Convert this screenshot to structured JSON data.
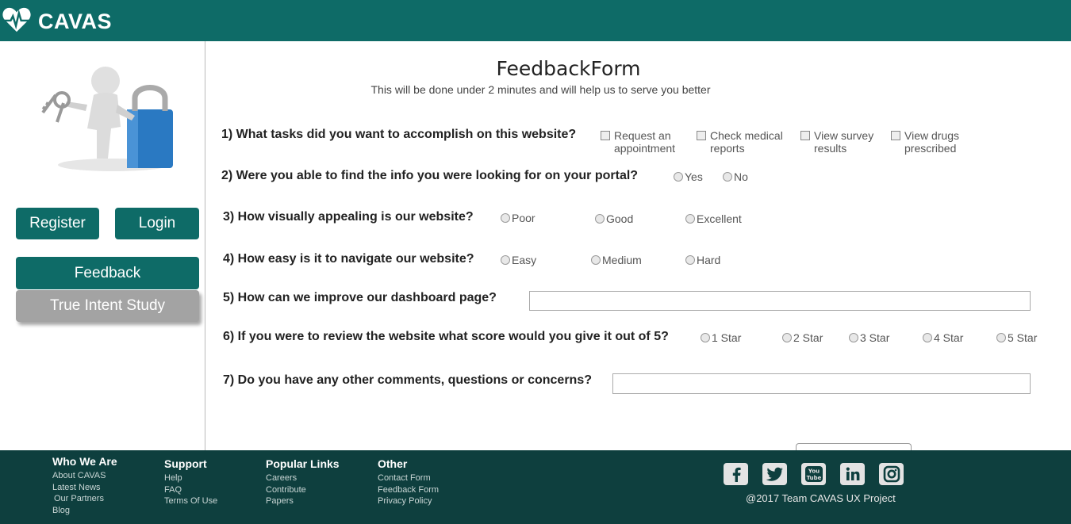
{
  "brand": {
    "name": "CAVAS"
  },
  "sidebar": {
    "register": "Register",
    "login": "Login",
    "feedback": "Feedback",
    "true_intent": "True Intent Study"
  },
  "form": {
    "title": "FeedbackForm",
    "subtitle": "This will be done under 2 minutes and will help us to serve you better",
    "q1": {
      "text": "1) What tasks did you want to accomplish on this website?",
      "options": [
        "Request an\nappointment",
        "Check medical\nreports",
        "View survey\nresults",
        "View drugs\nprescribed"
      ]
    },
    "q2": {
      "text": "2) Were you able to find the info you were looking for on your portal?",
      "options": [
        "Yes",
        "No"
      ]
    },
    "q3": {
      "text": "3) How visually appealing is our website?",
      "options": [
        "Poor",
        "Good",
        "Excellent"
      ]
    },
    "q4": {
      "text": "4) How easy is it to navigate our website?",
      "options": [
        "Easy",
        "Medium",
        "Hard"
      ]
    },
    "q5": {
      "text": "5) How can we improve our dashboard page?",
      "value": ""
    },
    "q6": {
      "text": "6) If you were to review the website what score would you give it out of 5?",
      "options": [
        "1 Star",
        "2 Star",
        "3 Star",
        "4 Star",
        "5 Star"
      ]
    },
    "q7": {
      "text": "7) Do you have any other comments, questions or concerns?",
      "value": ""
    }
  },
  "footer": {
    "who": {
      "heading": "Who We Are",
      "links": [
        "About CAVAS",
        "Latest News",
        "Our Partners",
        "Blog"
      ]
    },
    "support": {
      "heading": "Support",
      "links": [
        "Help",
        "FAQ",
        "Terms Of Use"
      ]
    },
    "popular": {
      "heading": "Popular Links",
      "links": [
        "Careers",
        "Contribute",
        "Papers"
      ]
    },
    "other": {
      "heading": "Other",
      "links": [
        "Contact Form",
        "Feedback Form",
        "Privacy Policy"
      ]
    },
    "social": [
      "facebook-icon",
      "twitter-icon",
      "youtube-icon",
      "linkedin-icon",
      "instagram-icon"
    ],
    "copyright": "@2017 Team CAVAS UX Project"
  },
  "colors": {
    "teal": "#0e6b67",
    "footer": "#0e3f3e",
    "grey_button": "#a3a3a3"
  }
}
